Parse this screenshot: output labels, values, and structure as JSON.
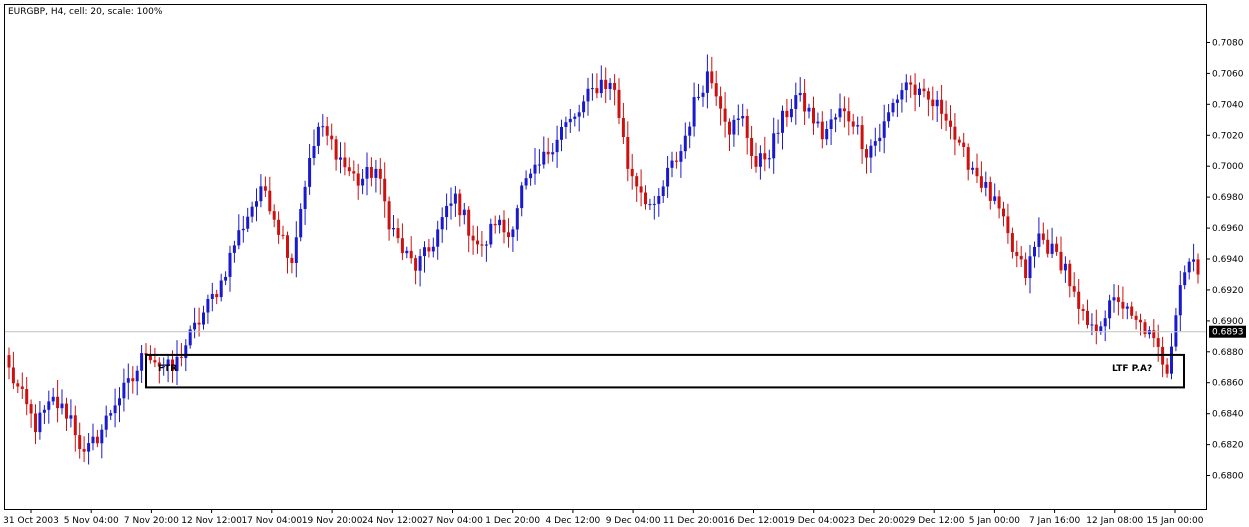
{
  "chart_data": {
    "type": "candlestick",
    "title": "EURGBP, H4, cell: 20, scale: 100%",
    "ylim": [
      0.679,
      0.709
    ],
    "y_ticks": [
      "0.7080",
      "0.7060",
      "0.7040",
      "0.7020",
      "0.7000",
      "0.6980",
      "0.6960",
      "0.6940",
      "0.6920",
      "0.6900",
      "0.6880",
      "0.6860",
      "0.6840",
      "0.6820",
      "0.6800"
    ],
    "current_price": "0.6893",
    "x_labels": [
      "31 Oct 2003",
      "5 Nov 04:00",
      "7 Nov 20:00",
      "12 Nov 12:00",
      "17 Nov 04:00",
      "19 Nov 20:00",
      "24 Nov 12:00",
      "27 Nov 04:00",
      "1 Dec 20:00",
      "4 Dec 12:00",
      "9 Dec 04:00",
      "11 Dec 20:00",
      "16 Dec 12:00",
      "19 Dec 04:00",
      "23 Dec 20:00",
      "29 Dec 12:00",
      "5 Jan 00:00",
      "7 Jan 16:00",
      "12 Jan 08:00",
      "15 Jan 00:00"
    ],
    "bull_color": "#1a1acd",
    "bear_color": "#cc1111",
    "close_path": [
      [
        0,
        0.6868
      ],
      [
        6,
        0.6832
      ],
      [
        10,
        0.6848
      ],
      [
        14,
        0.6838
      ],
      [
        17,
        0.6812
      ],
      [
        21,
        0.683
      ],
      [
        24,
        0.6848
      ],
      [
        28,
        0.6862
      ],
      [
        31,
        0.6882
      ],
      [
        34,
        0.6872
      ],
      [
        37,
        0.6868
      ],
      [
        40,
        0.6885
      ],
      [
        44,
        0.6905
      ],
      [
        48,
        0.6925
      ],
      [
        51,
        0.695
      ],
      [
        55,
        0.6975
      ],
      [
        58,
        0.6985
      ],
      [
        61,
        0.696
      ],
      [
        64,
        0.694
      ],
      [
        67,
        0.699
      ],
      [
        70,
        0.7025
      ],
      [
        73,
        0.7015
      ],
      [
        76,
        0.7
      ],
      [
        79,
        0.699
      ],
      [
        83,
        0.6998
      ],
      [
        86,
        0.6965
      ],
      [
        89,
        0.6945
      ],
      [
        92,
        0.6935
      ],
      [
        95,
        0.6945
      ],
      [
        98,
        0.6965
      ],
      [
        101,
        0.698
      ],
      [
        104,
        0.696
      ],
      [
        107,
        0.6945
      ],
      [
        110,
        0.6965
      ],
      [
        113,
        0.6955
      ],
      [
        116,
        0.6985
      ],
      [
        119,
        0.6995
      ],
      [
        122,
        0.701
      ],
      [
        125,
        0.7025
      ],
      [
        128,
        0.703
      ],
      [
        131,
        0.7045
      ],
      [
        134,
        0.7055
      ],
      [
        137,
        0.705
      ],
      [
        140,
        0.7
      ],
      [
        143,
        0.6985
      ],
      [
        146,
        0.697
      ],
      [
        149,
        0.6995
      ],
      [
        152,
        0.701
      ],
      [
        155,
        0.704
      ],
      [
        158,
        0.706
      ],
      [
        160,
        0.705
      ],
      [
        163,
        0.7025
      ],
      [
        166,
        0.703
      ],
      [
        169,
        0.7
      ],
      [
        172,
        0.701
      ],
      [
        175,
        0.703
      ],
      [
        178,
        0.7045
      ],
      [
        181,
        0.7035
      ],
      [
        184,
        0.702
      ],
      [
        188,
        0.7035
      ],
      [
        191,
        0.703
      ],
      [
        194,
        0.701
      ],
      [
        197,
        0.702
      ],
      [
        200,
        0.704
      ],
      [
        203,
        0.7055
      ],
      [
        206,
        0.7045
      ],
      [
        209,
        0.704
      ],
      [
        212,
        0.7035
      ],
      [
        215,
        0.701
      ],
      [
        218,
        0.7
      ],
      [
        221,
        0.6985
      ],
      [
        224,
        0.697
      ],
      [
        227,
        0.6945
      ],
      [
        230,
        0.693
      ],
      [
        233,
        0.6955
      ],
      [
        236,
        0.6945
      ],
      [
        239,
        0.6935
      ],
      [
        242,
        0.6905
      ],
      [
        245,
        0.6893
      ],
      [
        248,
        0.6905
      ],
      [
        251,
        0.6915
      ],
      [
        254,
        0.69
      ],
      [
        257,
        0.6895
      ],
      [
        260,
        0.688
      ],
      [
        262,
        0.687
      ],
      [
        265,
        0.6925
      ],
      [
        268,
        0.6945
      ],
      [
        269,
        0.693
      ]
    ],
    "annotations": [
      {
        "label": "FTR",
        "price_top": 0.6878,
        "price_bottom": 0.6857
      },
      {
        "label": "LTF P.A?"
      }
    ]
  }
}
